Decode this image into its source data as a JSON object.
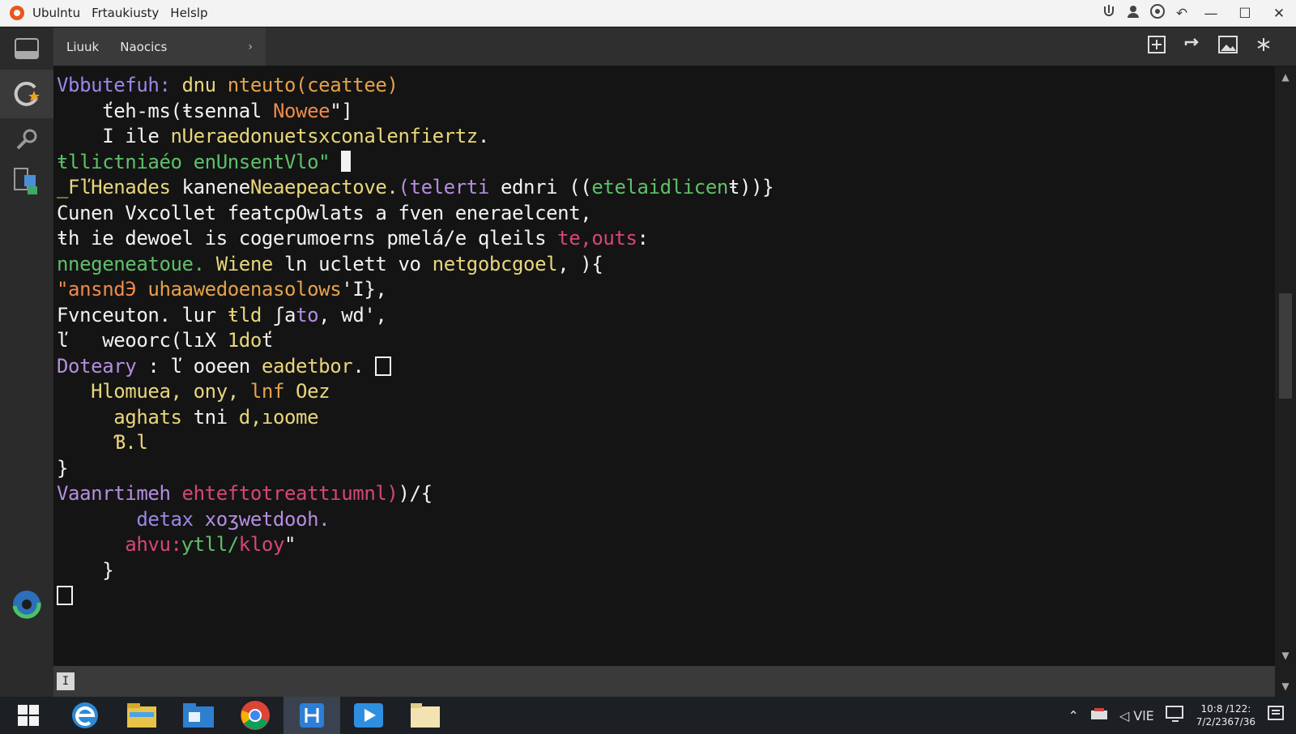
{
  "titlebar": {
    "menu": [
      "Ubulntu",
      "Frtaukiusty",
      "Helslp"
    ],
    "icons": [
      "share-icon",
      "user-icon",
      "sync-icon",
      "undo-icon"
    ],
    "window_controls": [
      "minimize-icon",
      "maximize-icon",
      "close-icon"
    ]
  },
  "tabbar": {
    "tab_items": [
      "Liuuk",
      "Naocics"
    ],
    "chevron": "›",
    "actions": [
      "split-icon",
      "refresh-icon",
      "image-icon",
      "pin-icon"
    ]
  },
  "editor": {
    "lines": [
      [
        {
          "t": "Vbbutefuh: ",
          "c": "c-purple"
        },
        {
          "t": "dnu ",
          "c": "c-yellow"
        },
        {
          "t": "nteuto(ceattee)",
          "c": "c-amber"
        }
      ],
      [
        {
          "t": "    ťeh-ms(ŧsennal ",
          "c": "c-white"
        },
        {
          "t": "Nowee",
          "c": "c-orange"
        },
        {
          "t": "\"]",
          "c": "c-white"
        }
      ],
      [
        {
          "t": "    I ile ",
          "c": "c-white"
        },
        {
          "t": "nUeraedonuetsxconalenfiertz",
          "c": "c-yellow"
        },
        {
          "t": ".",
          "c": "c-white"
        }
      ],
      [
        {
          "t": "ŧllictniaéo enUnsentVlo\" ",
          "c": "c-green"
        },
        {
          "t": "",
          "c": "cursor"
        }
      ],
      [
        {
          "t": "_FľHenades ",
          "c": "c-yellow"
        },
        {
          "t": "kanene",
          "c": "c-white"
        },
        {
          "t": "Neaepeactove.",
          "c": "c-yellow"
        },
        {
          "t": "(telerti ",
          "c": "c-lpurple"
        },
        {
          "t": "ednri ((",
          "c": "c-white"
        },
        {
          "t": "etelaidlicen",
          "c": "c-green"
        },
        {
          "t": "ŧ))}",
          "c": "c-white"
        }
      ],
      [
        {
          "t": "Cunen Vxcollet featcpOwlats a fven eneraelcent,",
          "c": "c-white"
        }
      ],
      [
        {
          "t": "ŧh ie dewoel is cogerumoerns pmelá/e qleils ",
          "c": "c-white"
        },
        {
          "t": "te,outs",
          "c": "c-pink"
        },
        {
          "t": ":",
          "c": "c-white"
        }
      ],
      [
        {
          "t": "nnegeneatoue. ",
          "c": "c-green"
        },
        {
          "t": "Wiene ",
          "c": "c-yellow"
        },
        {
          "t": "ln uclett vo ",
          "c": "c-white"
        },
        {
          "t": "netgobcgoel",
          "c": "c-yellow"
        },
        {
          "t": ", ){",
          "c": "c-white"
        }
      ],
      [
        {
          "t": "\"ansndЭ ",
          "c": "c-orange"
        },
        {
          "t": "uhaawedoenasolows",
          "c": "c-amber"
        },
        {
          "t": "'I},",
          "c": "c-white"
        }
      ],
      [
        {
          "t": "Fvnceuton. lur ",
          "c": "c-white"
        },
        {
          "t": "ŧld ",
          "c": "c-yellow"
        },
        {
          "t": "ʃa",
          "c": "c-white"
        },
        {
          "t": "to",
          "c": "c-lpurple"
        },
        {
          "t": ", wd',",
          "c": "c-white"
        }
      ],
      [
        {
          "t": "ľ   weoorc(lıX ",
          "c": "c-white"
        },
        {
          "t": "1do",
          "c": "c-yellow"
        },
        {
          "t": "ť",
          "c": "c-white"
        }
      ],
      [
        {
          "t": "Doteary ",
          "c": "c-lpurple"
        },
        {
          "t": ": ľ ooeen ",
          "c": "c-white"
        },
        {
          "t": "eadetbor",
          "c": "c-yellow"
        },
        {
          "t": ". ",
          "c": "c-white"
        },
        {
          "t": "",
          "c": "box"
        }
      ],
      [
        {
          "t": "   Hlomuea, ony, ",
          "c": "c-yellow"
        },
        {
          "t": "lnf ",
          "c": "c-amber"
        },
        {
          "t": "Oez",
          "c": "c-yellow"
        }
      ],
      [
        {
          "t": "     aghats ",
          "c": "c-yellow"
        },
        {
          "t": "tni",
          "c": "c-white"
        },
        {
          "t": " d,ıoome",
          "c": "c-yellow"
        }
      ],
      [
        {
          "t": "     Ɓ.l",
          "c": "c-yellow"
        }
      ],
      [
        {
          "t": "}",
          "c": "c-white"
        }
      ],
      [
        {
          "t": "Vaanrtimeh ",
          "c": "c-lpurple"
        },
        {
          "t": "ehteftotreattıumnl)",
          "c": "c-pink"
        },
        {
          "t": ")/{",
          "c": "c-white"
        }
      ],
      [
        {
          "t": "       detax ",
          "c": "c-purple"
        },
        {
          "t": "xoʒwetdooh.",
          "c": "c-lpurple"
        }
      ],
      [
        {
          "t": "      ahvu:",
          "c": "c-pink"
        },
        {
          "t": "ƴtll/",
          "c": "c-green"
        },
        {
          "t": "kloy",
          "c": "c-pink"
        },
        {
          "t": "\"",
          "c": "c-white"
        }
      ],
      [
        {
          "t": "    }",
          "c": "c-white"
        }
      ],
      [
        {
          "t": "",
          "c": "box"
        }
      ]
    ]
  },
  "statusbar": {
    "cursor_glyph": "I"
  },
  "taskbar": {
    "apps": [
      "windows-start-icon",
      "edge-browser-icon",
      "file-explorer-icon",
      "photos-icon",
      "chrome-icon",
      "vscode-icon",
      "media-player-icon",
      "folder-icon"
    ],
    "tray_text": "◁ VlE",
    "clock_time": "10:8 /122:",
    "clock_date": "7/2/2367/36"
  }
}
